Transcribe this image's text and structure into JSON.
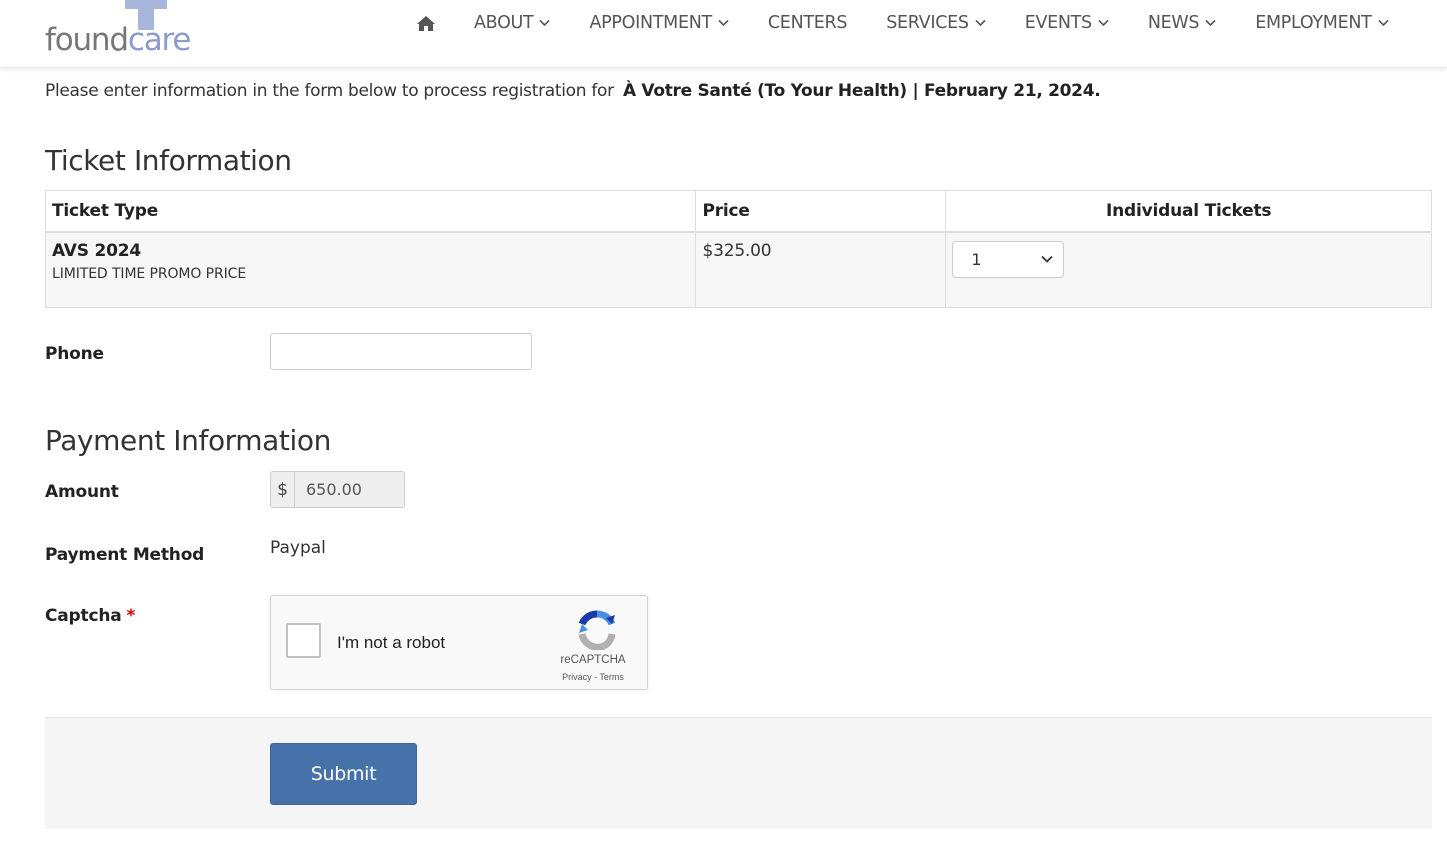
{
  "brand": {
    "name_part1": "found",
    "name_part2": "care"
  },
  "nav": {
    "home_icon": "home-icon",
    "items": [
      {
        "label": "ABOUT",
        "has_dropdown": true
      },
      {
        "label": "APPOINTMENT",
        "has_dropdown": true
      },
      {
        "label": "CENTERS",
        "has_dropdown": false
      },
      {
        "label": "SERVICES",
        "has_dropdown": true
      },
      {
        "label": "EVENTS",
        "has_dropdown": true
      },
      {
        "label": "NEWS",
        "has_dropdown": true
      },
      {
        "label": "EMPLOYMENT",
        "has_dropdown": true
      }
    ]
  },
  "intro": {
    "text": "Please enter information in the form below to process registration for",
    "event": "À Votre Santé (To Your Health) | February 21, 2024."
  },
  "ticket_section": {
    "title": "Ticket Information",
    "columns": [
      "Ticket Type",
      "Price",
      "Individual Tickets"
    ],
    "rows": [
      {
        "name": "AVS 2024",
        "description": "LIMITED TIME PROMO PRICE",
        "price": "$325.00",
        "quantity": "1"
      }
    ]
  },
  "phone": {
    "label": "Phone",
    "value": ""
  },
  "payment_section": {
    "title": "Payment Information",
    "amount_label": "Amount",
    "currency_symbol": "$",
    "amount_value": "650.00",
    "method_label": "Payment Method",
    "method_value": "Paypal",
    "captcha_label": "Captcha",
    "required_mark": "*"
  },
  "captcha": {
    "checkbox_text": "I'm not a robot",
    "brand": "reCAPTCHA",
    "links": "Privacy - Terms"
  },
  "submit": {
    "label": "Submit"
  },
  "colors": {
    "accent": "#4672a9",
    "logo_blue": "#8a9bcc",
    "required": "#dd0000"
  }
}
